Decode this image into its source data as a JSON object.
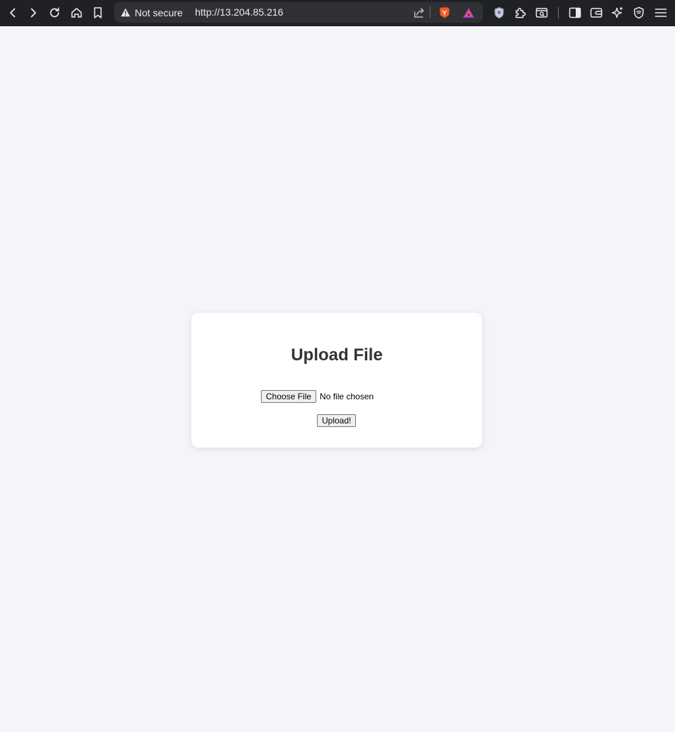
{
  "browser": {
    "security_label": "Not secure",
    "url": "http://13.204.85.216"
  },
  "page": {
    "title": "Upload File",
    "file_input": {
      "button_label": "Choose File",
      "status": "No file chosen"
    },
    "submit_label": "Upload!"
  },
  "colors": {
    "page_background": "#f4f5f9",
    "card_background": "#ffffff",
    "heading": "#333333",
    "toolbar": "#202124"
  }
}
